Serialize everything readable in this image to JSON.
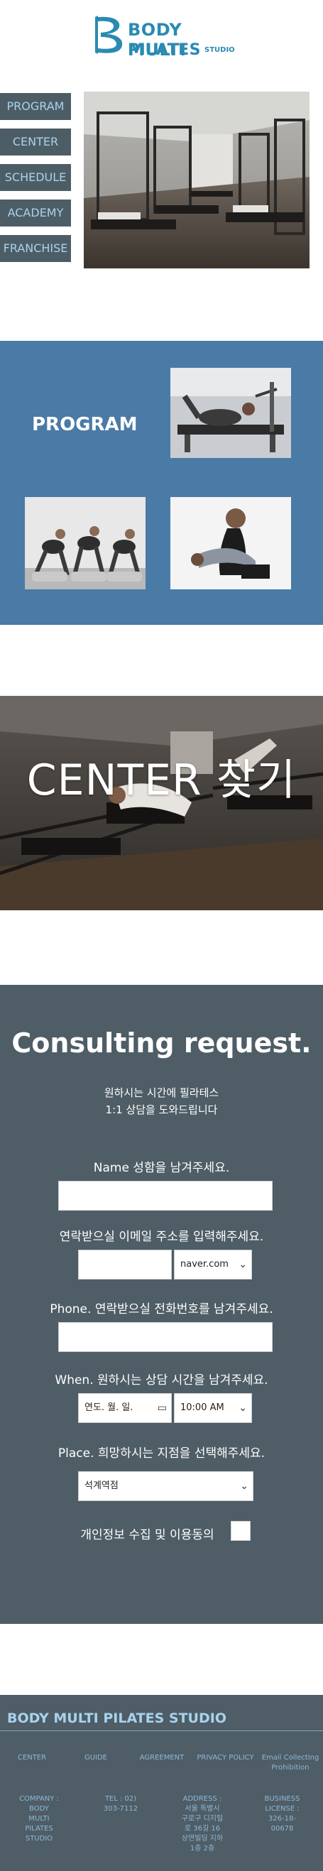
{
  "brand": {
    "name_line1": "BODY MULTI",
    "name_line2": "PILATES",
    "name_suffix": "STUDIO",
    "color": "#2a8ab2"
  },
  "nav": {
    "items": [
      {
        "label": "PROGRAM"
      },
      {
        "label": "CENTER"
      },
      {
        "label": "SCHEDULE"
      },
      {
        "label": "ACADEMY"
      },
      {
        "label": "FRANCHISE"
      }
    ]
  },
  "program": {
    "title": "PROGRAM"
  },
  "center": {
    "title": "CENTER 찾기"
  },
  "consult": {
    "title": "Consulting request.",
    "subtitle_line1": "원하시는 시간에 필라테스",
    "subtitle_line2": "1:1 상담을 도와드립니다",
    "name_label": "Name 성함을 남겨주세요.",
    "email_label": "연락받으실 이메일 주소를 입력해주세요.",
    "email_domain": "naver.com",
    "phone_label": "Phone. 연락받으실 전화번호를 남겨주세요.",
    "when_label": "When. 원하시는 상담 시간을 남겨주세요.",
    "date_placeholder": "연도. 월. 일.",
    "time_value": "10:00 AM",
    "place_label": "Place. 희망하시는 지점을 선택해주세요.",
    "place_value": "석계역점",
    "agree_label": "개인정보 수집 및 이용동의"
  },
  "footer": {
    "title": "BODY MULTI PILATES STUDIO",
    "links": [
      {
        "label": "CENTER"
      },
      {
        "label": "GUIDE"
      },
      {
        "label": "AGREEMENT"
      },
      {
        "label": "PRIVACY POLICY"
      },
      {
        "label": "Email Collecting Prohibition"
      }
    ],
    "company": "COMPANY : BODY MULTI PILATES STUDIO",
    "tel": "TEL : 02) 303-7112",
    "address": "ADDRESS : 서울 특별시 구로구 디지털로 36길 16 상연빌딩 지하1층 2층",
    "license": "BUSINESS LICENSE : 326-18-00678"
  },
  "colors": {
    "nav_bg": "#4d5d66",
    "nav_text": "#a9d2ec",
    "program_bg": "#4a7aa6",
    "consult_bg": "#4e5d66"
  }
}
